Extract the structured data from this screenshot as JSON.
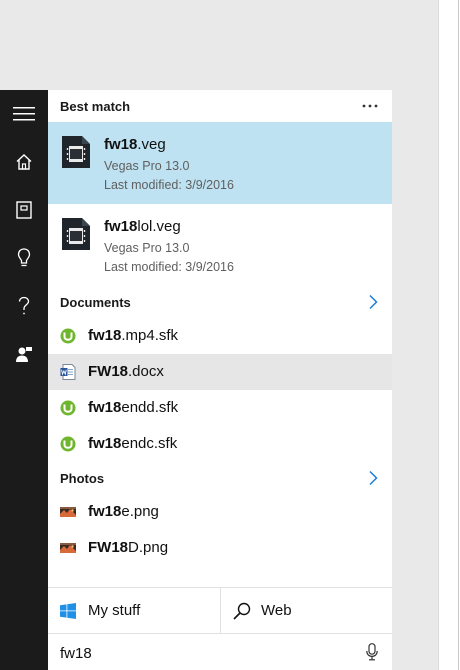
{
  "best_match": {
    "header": "Best match",
    "items": [
      {
        "name_bold": "fw18",
        "name_rest": ".veg",
        "app": "Vegas Pro 13.0",
        "modified": "Last modified: 3/9/2016",
        "icon": "vegas-file-icon"
      },
      {
        "name_bold": "fw18",
        "name_rest": "lol.veg",
        "app": "Vegas Pro 13.0",
        "modified": "Last modified: 3/9/2016",
        "icon": "vegas-file-icon"
      }
    ]
  },
  "documents": {
    "header": "Documents",
    "items": [
      {
        "name_bold": "fw18",
        "name_rest": ".mp4.sfk",
        "icon": "utorrent-icon"
      },
      {
        "name_bold": "FW18",
        "name_rest": ".docx",
        "icon": "word-doc-icon"
      },
      {
        "name_bold": "fw18",
        "name_rest": "endd.sfk",
        "icon": "utorrent-icon"
      },
      {
        "name_bold": "fw18",
        "name_rest": "endc.sfk",
        "icon": "utorrent-icon"
      }
    ]
  },
  "photos": {
    "header": "Photos",
    "items": [
      {
        "name_bold": "fw18",
        "name_rest": "e.png",
        "icon": "image-file-icon"
      },
      {
        "name_bold": "FW18",
        "name_rest": "D.png",
        "icon": "image-file-icon"
      }
    ]
  },
  "bottom": {
    "my_stuff": "My stuff",
    "web": "Web"
  },
  "search": {
    "value": "fw18"
  },
  "colors": {
    "selected_bg": "#bee2f2",
    "hover_bg": "#e6e6e6",
    "rail_bg": "#1b1b1b",
    "accent": "#1e7fd6"
  }
}
